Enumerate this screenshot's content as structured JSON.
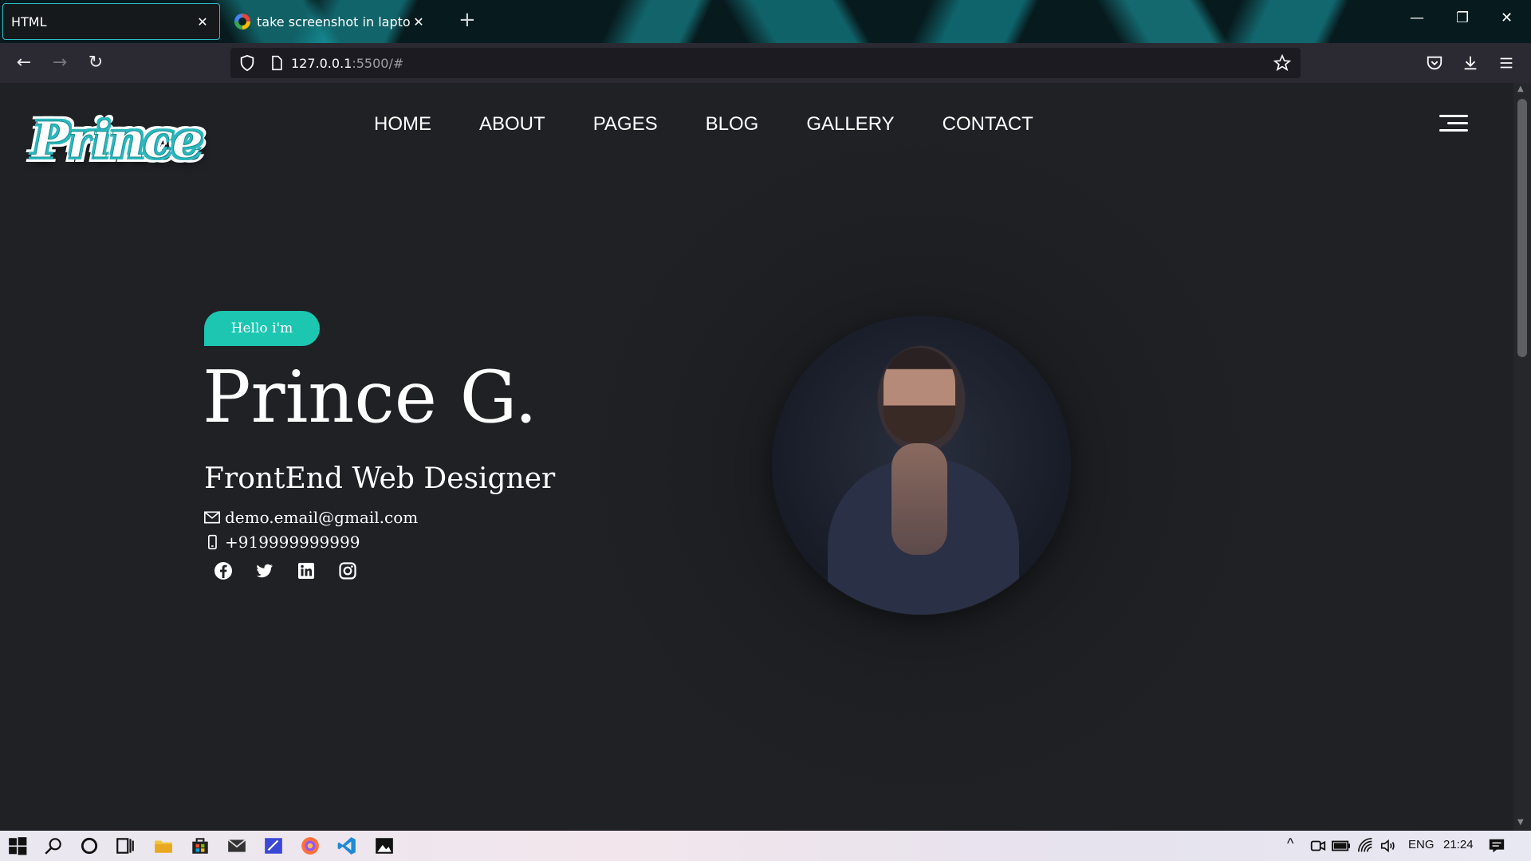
{
  "browser": {
    "tabs": [
      {
        "title": "HTML",
        "active": true
      },
      {
        "title": "take screenshot in laptop windo",
        "active": false
      }
    ],
    "url_host": "127.0.0.1",
    "url_path": ":5500/#"
  },
  "site": {
    "logo_text": "Prince",
    "nav": [
      "HOME",
      "ABOUT",
      "PAGES",
      "BLOG",
      "GALLERY",
      "CONTACT"
    ],
    "hero": {
      "greeting": "Hello i'm",
      "name": "Prince G.",
      "role": "FrontEnd Web Designer",
      "email": "demo.email@gmail.com",
      "phone": "+919999999999"
    },
    "socials": [
      "facebook-icon",
      "twitter-icon",
      "linkedin-icon",
      "instagram-icon"
    ],
    "accent_color": "#1cc6b1"
  },
  "taskbar": {
    "language": "ENG",
    "time": "21:24"
  }
}
